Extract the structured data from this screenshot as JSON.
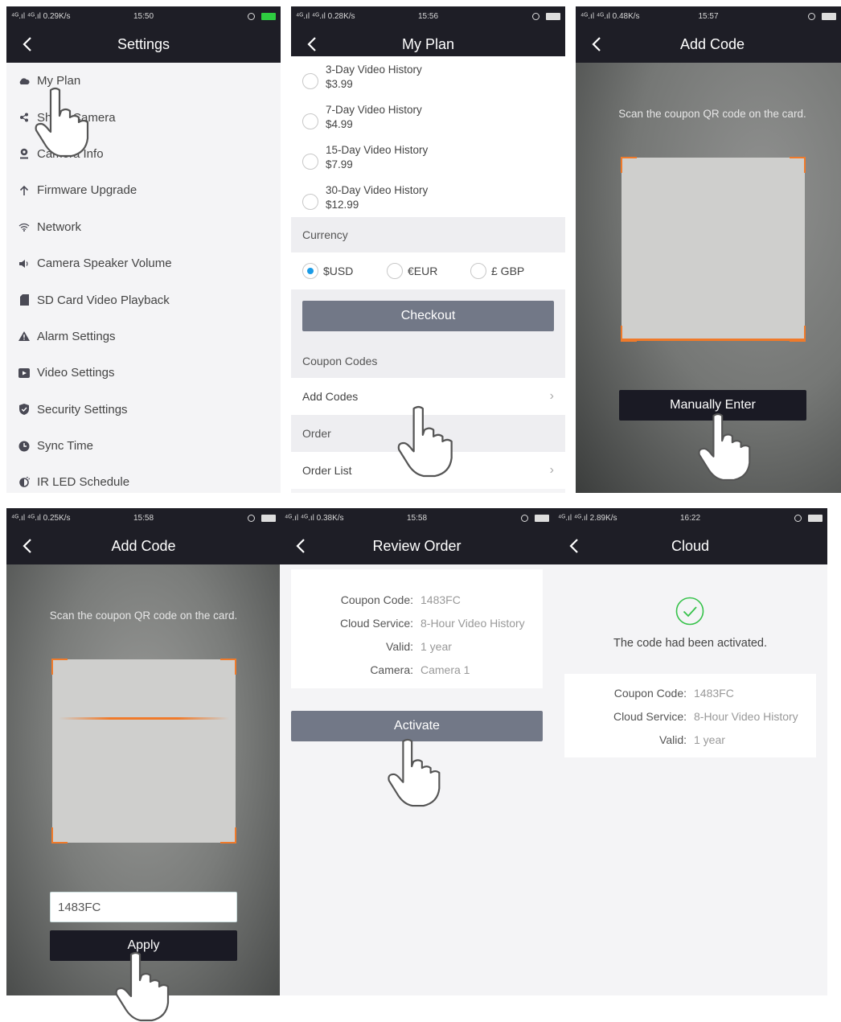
{
  "screens": {
    "settings": {
      "status": {
        "signal": "⁴ᴳ.ıl ⁴ᴳ.ıl 0.29K/s",
        "time": "15:50"
      },
      "title": "Settings",
      "items": [
        {
          "icon": "cloud-icon",
          "label": "My Plan"
        },
        {
          "icon": "share-icon",
          "label": "Share Camera"
        },
        {
          "icon": "camera-icon",
          "label": "Camera Info"
        },
        {
          "icon": "arrow-up-icon",
          "label": "Firmware Upgrade"
        },
        {
          "icon": "wifi-icon",
          "label": "Network"
        },
        {
          "icon": "speaker-icon",
          "label": "Camera Speaker Volume"
        },
        {
          "icon": "sd-card-icon",
          "label": "SD Card Video Playback"
        },
        {
          "icon": "alarm-icon",
          "label": "Alarm Settings"
        },
        {
          "icon": "video-icon",
          "label": "Video Settings"
        },
        {
          "icon": "shield-icon",
          "label": "Security Settings"
        },
        {
          "icon": "clock-icon",
          "label": "Sync Time"
        },
        {
          "icon": "ir-led-icon",
          "label": "IR LED Schedule"
        }
      ]
    },
    "myplan": {
      "status": {
        "signal": "⁴ᴳ.ıl ⁴ᴳ.ıl 0.28K/s",
        "time": "15:56"
      },
      "title": "My Plan",
      "plans": [
        {
          "name": "3-Day Video History",
          "price": "$3.99"
        },
        {
          "name": "7-Day Video History",
          "price": "$4.99"
        },
        {
          "name": "15-Day Video History",
          "price": "$7.99"
        },
        {
          "name": "30-Day Video History",
          "price": "$12.99"
        }
      ],
      "currency_label": "Currency",
      "currencies": [
        "$USD",
        "€EUR",
        "£ GBP"
      ],
      "checkout": "Checkout",
      "coupon_label": "Coupon Codes",
      "add_codes": "Add Codes",
      "order_label": "Order",
      "order_list": "Order List"
    },
    "addcode1": {
      "status": {
        "signal": "⁴ᴳ.ıl ⁴ᴳ.ıl 0.48K/s",
        "time": "15:57"
      },
      "title": "Add Code",
      "hint": "Scan the coupon QR code on the card.",
      "manual": "Manually Enter"
    },
    "addcode2": {
      "status": {
        "signal": "⁴ᴳ.ıl ⁴ᴳ.ıl 0.25K/s",
        "time": "15:58"
      },
      "title": "Add Code",
      "hint": "Scan the coupon QR code on the card.",
      "code_value": "1483FC",
      "apply": "Apply"
    },
    "review": {
      "status": {
        "signal": "⁴ᴳ.ıl ⁴ᴳ.ıl 0.38K/s",
        "time": "15:58"
      },
      "title": "Review Order",
      "rows": [
        {
          "k": "Coupon Code:",
          "v": "1483FC"
        },
        {
          "k": "Cloud Service:",
          "v": "8-Hour Video History"
        },
        {
          "k": "Valid:",
          "v": "1 year"
        },
        {
          "k": "Camera:",
          "v": "Camera 1"
        }
      ],
      "activate": "Activate"
    },
    "cloud": {
      "status": {
        "signal": "⁴ᴳ.ıl ⁴ᴳ.ıl 2.89K/s",
        "time": "16:22"
      },
      "title": "Cloud",
      "message": "The code had been activated.",
      "rows": [
        {
          "k": "Coupon Code:",
          "v": "1483FC"
        },
        {
          "k": "Cloud Service:",
          "v": "8-Hour Video History"
        },
        {
          "k": "Valid:",
          "v": "1 year"
        }
      ]
    }
  },
  "colors": {
    "nav_bg": "#1e1e26",
    "accent_blue": "#1a9be6",
    "scan_orange": "#f07a2a",
    "success_green": "#36c24a",
    "button_gray": "#727887"
  }
}
